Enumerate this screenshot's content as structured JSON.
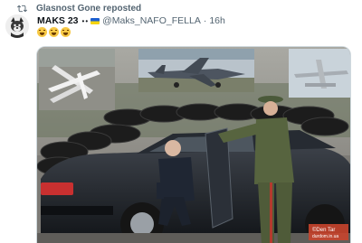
{
  "repost": {
    "text": "Glasnost Gone reposted",
    "icon": "repost-icon"
  },
  "author": {
    "display_name": "MAKS 23",
    "badges": "••",
    "handle": "@Maks_NAFO_FELLA",
    "separator": "·",
    "time": "16h"
  },
  "tweet": {
    "emoji_count": 3,
    "emoji": "grinning-face"
  },
  "media": {
    "watermark_line1": "©Den Tar",
    "watermark_line2": "durdom.in.ua",
    "panels": [
      "strategic-bomber-overhead",
      "fighter-jet-parked",
      "bomber-flying"
    ]
  },
  "colors": {
    "muted": "#536471",
    "text": "#0f1419",
    "border": "#cfd9de",
    "flag_blue": "#1d5fcf",
    "flag_yellow": "#f5d40f"
  }
}
